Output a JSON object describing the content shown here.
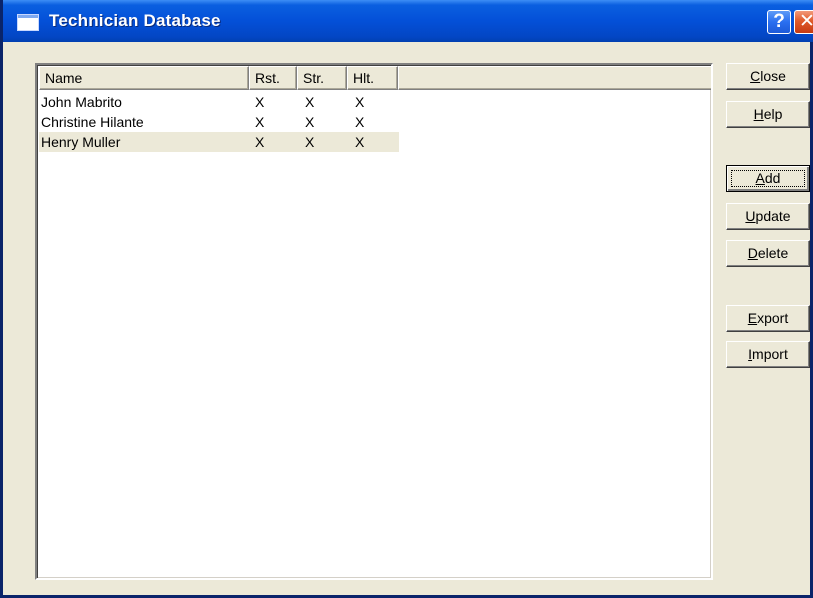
{
  "window": {
    "title": "Technician Database",
    "help_glyph": "?",
    "close_glyph": "✕"
  },
  "colors": {
    "titlebar": "#0450d8",
    "face": "#ece9d8",
    "list_bg": "#ffffff",
    "close_button": "#e05a2a"
  },
  "table": {
    "columns": [
      "Name",
      "Rst.",
      "Str.",
      "Hlt."
    ],
    "rows": [
      {
        "name": "John Mabrito",
        "rst": "X",
        "str": "X",
        "hlt": "X"
      },
      {
        "name": "Christine Hilante",
        "rst": "X",
        "str": "X",
        "hlt": "X"
      },
      {
        "name": "Henry Muller",
        "rst": "X",
        "str": "X",
        "hlt": "X"
      }
    ],
    "selected_row": "Henry Muller"
  },
  "buttons": {
    "close": {
      "mnemonic": "C",
      "rest": "lose"
    },
    "help": {
      "mnemonic": "H",
      "rest": "elp"
    },
    "add": {
      "mnemonic": "A",
      "rest": "dd"
    },
    "update": {
      "mnemonic": "U",
      "rest": "pdate"
    },
    "delete": {
      "mnemonic": "D",
      "rest": "elete"
    },
    "export": {
      "mnemonic": "E",
      "rest": "xport"
    },
    "import": {
      "mnemonic": "I",
      "rest": "mport"
    }
  }
}
